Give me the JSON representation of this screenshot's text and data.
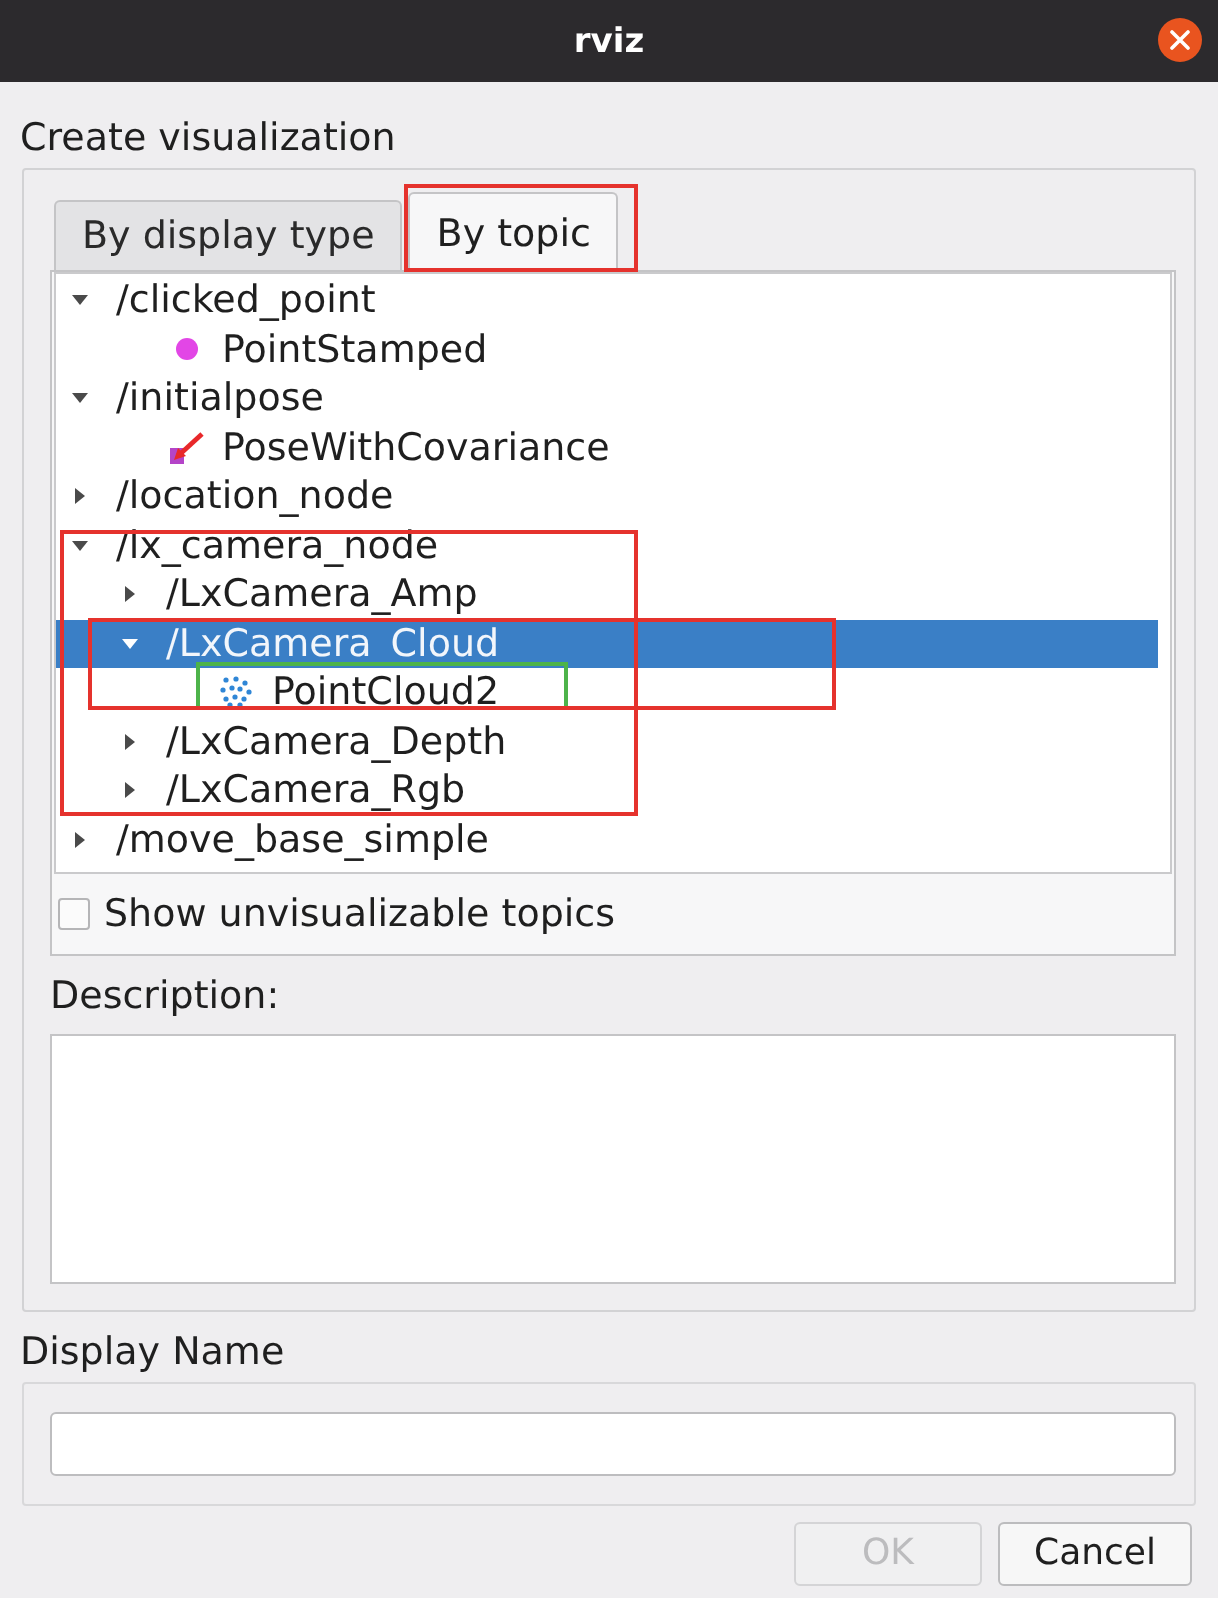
{
  "window": {
    "title": "rviz"
  },
  "heading": "Create visualization",
  "tabs": [
    {
      "label": "By display type",
      "selected": false
    },
    {
      "label": "By topic",
      "selected": true,
      "highlight": {
        "color": "#e5322d"
      }
    }
  ],
  "topic_tree": [
    {
      "kind": "topic",
      "label": "/clicked_point",
      "expanded": true,
      "selected": false,
      "children": [
        {
          "kind": "point",
          "label": "PointStamped",
          "selected": false
        }
      ]
    },
    {
      "kind": "topic",
      "label": "/initialpose",
      "expanded": true,
      "selected": false,
      "children": [
        {
          "kind": "pose",
          "label": "PoseWithCovariance",
          "selected": false
        }
      ]
    },
    {
      "kind": "topic",
      "label": "/location_node",
      "expanded": false,
      "selected": false
    },
    {
      "kind": "topic",
      "label": "/lx_camera_node",
      "expanded": true,
      "selected": false,
      "highlight": {
        "color": "#e5322d"
      },
      "children": [
        {
          "kind": "topic",
          "label": "/LxCamera_Amp",
          "expanded": false,
          "selected": false
        },
        {
          "kind": "topic",
          "label": "/LxCamera_Cloud",
          "expanded": true,
          "selected": true,
          "highlight": {
            "color": "#e5322d"
          },
          "children": [
            {
              "kind": "cloud",
              "label": "PointCloud2",
              "selected": false,
              "highlight": {
                "color": "#4db34a"
              }
            }
          ]
        },
        {
          "kind": "topic",
          "label": "/LxCamera_Depth",
          "expanded": false,
          "selected": false
        },
        {
          "kind": "topic",
          "label": "/LxCamera_Rgb",
          "expanded": false,
          "selected": false
        }
      ]
    },
    {
      "kind": "topic",
      "label": "/move_base_simple",
      "expanded": false,
      "selected": false
    }
  ],
  "show_unvisualizable": {
    "label": "Show unvisualizable topics",
    "checked": false
  },
  "description": {
    "label": "Description:"
  },
  "display_name": {
    "label": "Display Name"
  },
  "buttons": [
    {
      "label": "OK",
      "disabled": true
    },
    {
      "label": "Cancel",
      "disabled": false
    }
  ]
}
